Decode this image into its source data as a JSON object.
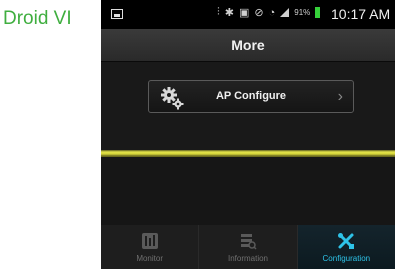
{
  "caption": "Droid VI",
  "status_bar": {
    "time": "10:17 AM",
    "battery_percent": "91%",
    "icons": [
      "picture-icon",
      "vibrate-icon",
      "bluetooth-icon",
      "nfc-icon",
      "mute-icon",
      "wifi-icon",
      "signal-icon",
      "battery-icon"
    ]
  },
  "header": {
    "title": "More"
  },
  "menu": {
    "ap_configure_label": "AP Configure"
  },
  "tabs": [
    {
      "label": "Monitor",
      "icon": "monitor-icon",
      "active": false
    },
    {
      "label": "Information",
      "icon": "information-icon",
      "active": false
    },
    {
      "label": "Configuration",
      "icon": "configuration-icon",
      "active": true
    }
  ],
  "colors": {
    "caption": "#3fae3f",
    "accent": "#2ec3e8",
    "divider": "#e3e34a",
    "battery": "#36d13a"
  }
}
